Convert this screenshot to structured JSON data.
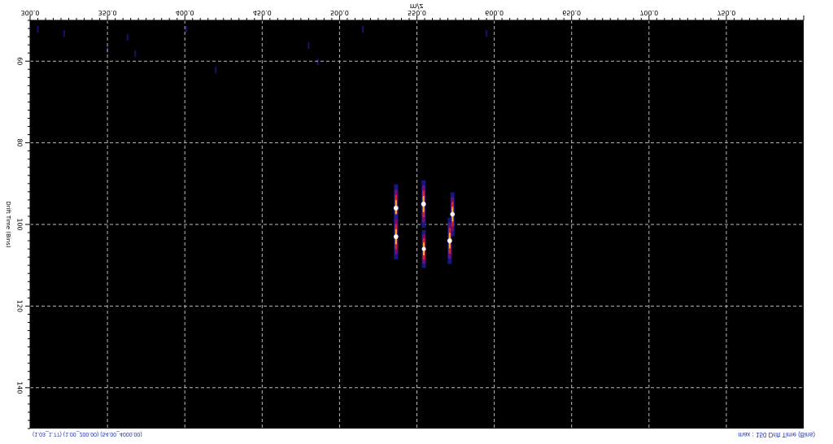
{
  "chart_data": {
    "type": "heatmap",
    "title": "",
    "xlabel": "m/z",
    "ylabel": "Drift Time (Bins)",
    "xlim": [
      300,
      800
    ],
    "ylim": [
      50,
      150
    ],
    "x_ticks": [
      "300.0",
      "350.0",
      "400.0",
      "450.0",
      "500.0",
      "550.0",
      "600.0",
      "650.0",
      "700.0",
      "750.0"
    ],
    "y_ticks": [
      "60",
      "80",
      "100",
      "120",
      "140"
    ],
    "x_tick_values": [
      300,
      350,
      400,
      450,
      500,
      550,
      600,
      650,
      700,
      750
    ],
    "y_tick_values": [
      60,
      80,
      100,
      120,
      140
    ],
    "grid": true,
    "background_color": "#000000",
    "grid_color": "#bbbbbb",
    "colormap": [
      "#000000",
      "#1a1a8c",
      "#7a0a6e",
      "#e02020",
      "#ffb020",
      "#ffffff"
    ],
    "peaks": [
      {
        "mz": 536.5,
        "drift": 96,
        "intensity": 0.95
      },
      {
        "mz": 536.5,
        "drift": 103,
        "intensity": 0.85
      },
      {
        "mz": 554.3,
        "drift": 95,
        "intensity": 0.95
      },
      {
        "mz": 554.5,
        "drift": 106,
        "intensity": 0.55
      },
      {
        "mz": 573.0,
        "drift": 97.5,
        "intensity": 0.8
      },
      {
        "mz": 571.2,
        "drift": 104,
        "intensity": 0.9
      }
    ],
    "noise": [
      {
        "mz": 305,
        "drift": 52
      },
      {
        "mz": 322,
        "drift": 53
      },
      {
        "mz": 350,
        "drift": 57
      },
      {
        "mz": 363,
        "drift": 54
      },
      {
        "mz": 368,
        "drift": 58
      },
      {
        "mz": 401,
        "drift": 52
      },
      {
        "mz": 480,
        "drift": 56
      },
      {
        "mz": 486,
        "drift": 60
      },
      {
        "mz": 515,
        "drift": 52
      },
      {
        "mz": 595,
        "drift": 53
      },
      {
        "mz": 420,
        "drift": 62
      }
    ]
  },
  "status": {
    "left": "(1.03_1.77) (1.00_200.00) (54.00_4000.00)",
    "right": "max : 150 Drift Time (Bins)"
  }
}
